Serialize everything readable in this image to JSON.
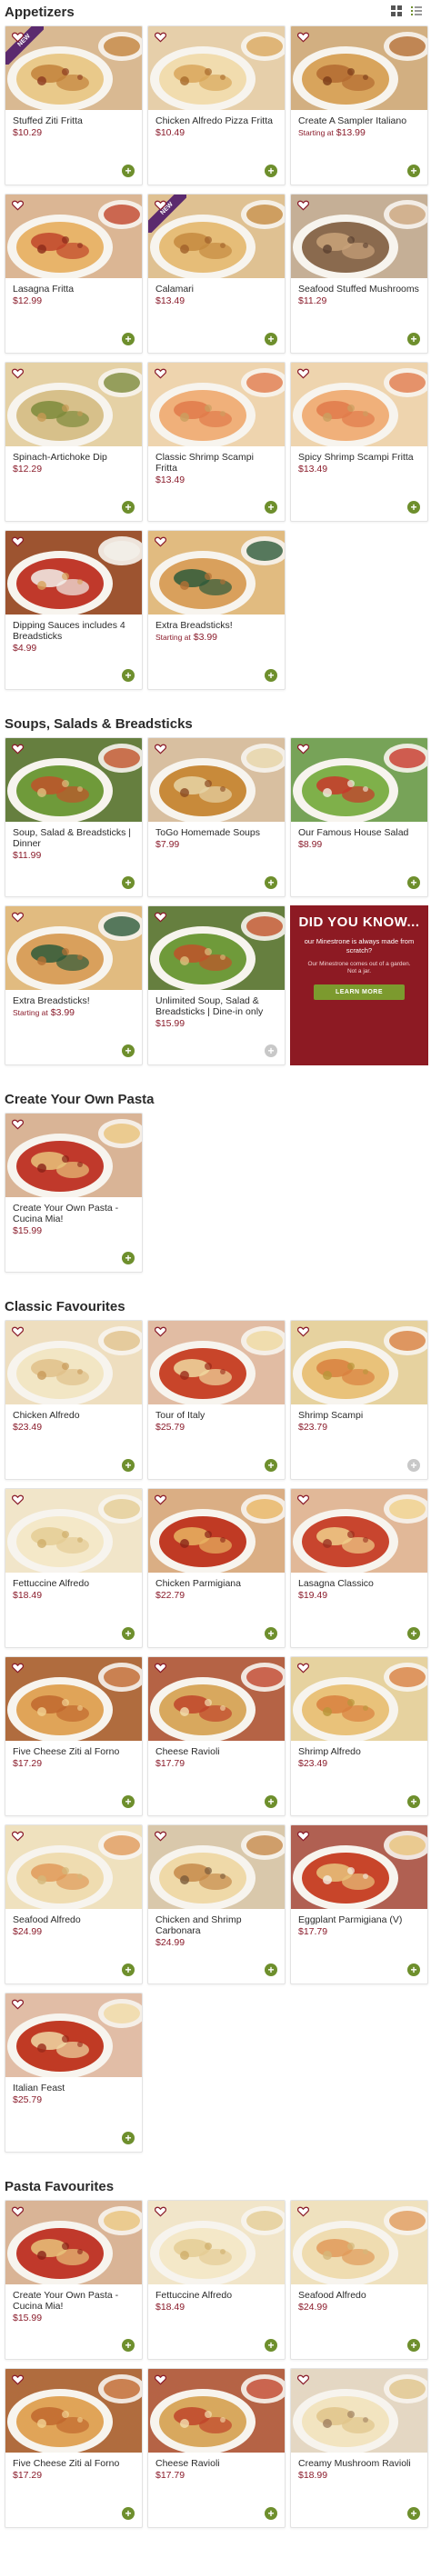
{
  "colors": {
    "accent_red": "#8a1c2b",
    "add_green": "#6e8f2d",
    "promo_bg": "#8d1a23",
    "new_badge": "#5b2a6e"
  },
  "view_toggle": {
    "grid_icon": "grid-view-icon",
    "list_icon": "list-view-icon"
  },
  "sections": [
    {
      "title": "Appetizers",
      "items": [
        {
          "name": "Stuffed Ziti Fritta",
          "price": "$10.29",
          "starting": "",
          "new": true,
          "img": "fritta"
        },
        {
          "name": "Chicken Alfredo Pizza Fritta",
          "price": "$10.49",
          "starting": "",
          "new": false,
          "img": "pizza-fritta"
        },
        {
          "name": "Create A Sampler Italiano",
          "price": "$13.99",
          "starting": "Starting at",
          "new": false,
          "img": "sampler"
        },
        {
          "name": "Lasagna Fritta",
          "price": "$12.99",
          "starting": "",
          "new": false,
          "img": "lasagna-fritta"
        },
        {
          "name": "Calamari",
          "price": "$13.49",
          "starting": "",
          "new": true,
          "img": "calamari"
        },
        {
          "name": "Seafood Stuffed Mushrooms",
          "price": "$11.29",
          "starting": "",
          "new": false,
          "img": "mushrooms"
        },
        {
          "name": "Spinach-Artichoke Dip",
          "price": "$12.29",
          "starting": "",
          "new": false,
          "img": "dip"
        },
        {
          "name": "Classic Shrimp Scampi Fritta",
          "price": "$13.49",
          "starting": "",
          "new": false,
          "img": "shrimp"
        },
        {
          "name": "Spicy Shrimp Scampi Fritta",
          "price": "$13.49",
          "starting": "",
          "new": false,
          "img": "shrimp"
        },
        {
          "name": "Dipping Sauces includes 4 Breadsticks",
          "price": "$4.99",
          "starting": "",
          "new": false,
          "img": "sauces"
        },
        {
          "name": "Extra Breadsticks!",
          "price": "$3.99",
          "starting": "Starting at",
          "new": false,
          "img": "breadsticks"
        }
      ]
    },
    {
      "title": "Soups, Salads & Breadsticks",
      "items": [
        {
          "name": "Soup, Salad & Breadsticks | Dinner",
          "price": "$11.99",
          "starting": "",
          "new": false,
          "img": "soup-salad"
        },
        {
          "name": "ToGo Homemade Soups",
          "price": "$7.99",
          "starting": "",
          "new": false,
          "img": "soups"
        },
        {
          "name": "Our Famous House Salad",
          "price": "$8.99",
          "starting": "",
          "new": false,
          "img": "salad"
        },
        {
          "name": "Extra Breadsticks!",
          "price": "$3.99",
          "starting": "Starting at",
          "new": false,
          "img": "breadsticks"
        },
        {
          "name": "Unlimited Soup, Salad & Breadsticks | Dine-in only",
          "price": "$15.99",
          "starting": "",
          "new": false,
          "img": "soup-salad",
          "disabled": true
        }
      ],
      "promo": {
        "title": "DID YOU KNOW...",
        "body": "our Minestrone is always made from scratch?",
        "sub": "Our Minestrone comes out of a garden. Not a jar.",
        "button": "LEARN MORE"
      }
    },
    {
      "title": "Create Your Own Pasta",
      "items": [
        {
          "name": "Create Your Own Pasta - Cucina Mia!",
          "price": "$15.99",
          "starting": "",
          "new": false,
          "img": "cyo"
        }
      ]
    },
    {
      "title": "Classic Favourites",
      "items": [
        {
          "name": "Chicken Alfredo",
          "price": "$23.49",
          "starting": "",
          "new": false,
          "img": "alfredo"
        },
        {
          "name": "Tour of Italy",
          "price": "$25.79",
          "starting": "",
          "new": false,
          "img": "tour"
        },
        {
          "name": "Shrimp Scampi",
          "price": "$23.79",
          "starting": "",
          "new": false,
          "img": "shrimp-pasta",
          "disabled": true
        },
        {
          "name": "Fettuccine Alfredo",
          "price": "$18.49",
          "starting": "",
          "new": false,
          "img": "fettuccine"
        },
        {
          "name": "Chicken Parmigiana",
          "price": "$22.79",
          "starting": "",
          "new": false,
          "img": "parm"
        },
        {
          "name": "Lasagna Classico",
          "price": "$19.49",
          "starting": "",
          "new": false,
          "img": "lasagna"
        },
        {
          "name": "Five Cheese Ziti al Forno",
          "price": "$17.29",
          "starting": "",
          "new": false,
          "img": "ziti"
        },
        {
          "name": "Cheese Ravioli",
          "price": "$17.79",
          "starting": "",
          "new": false,
          "img": "ravioli"
        },
        {
          "name": "Shrimp Alfredo",
          "price": "$23.49",
          "starting": "",
          "new": false,
          "img": "shrimp-pasta"
        },
        {
          "name": "Seafood Alfredo",
          "price": "$24.99",
          "starting": "",
          "new": false,
          "img": "seafood-alfredo"
        },
        {
          "name": "Chicken and Shrimp Carbonara",
          "price": "$24.99",
          "starting": "",
          "new": false,
          "img": "carbonara"
        },
        {
          "name": "Eggplant Parmigiana (V)",
          "price": "$17.79",
          "starting": "",
          "new": false,
          "img": "eggplant"
        },
        {
          "name": "Italian Feast",
          "price": "$25.79",
          "starting": "",
          "new": false,
          "img": "feast"
        }
      ]
    },
    {
      "title": "Pasta Favourites",
      "items": [
        {
          "name": "Create Your Own Pasta - Cucina Mia!",
          "price": "$15.99",
          "starting": "",
          "new": false,
          "img": "cyo"
        },
        {
          "name": "Fettuccine Alfredo",
          "price": "$18.49",
          "starting": "",
          "new": false,
          "img": "fettuccine"
        },
        {
          "name": "Seafood Alfredo",
          "price": "$24.99",
          "starting": "",
          "new": false,
          "img": "seafood-alfredo"
        },
        {
          "name": "Five Cheese Ziti al Forno",
          "price": "$17.29",
          "starting": "",
          "new": false,
          "img": "ziti"
        },
        {
          "name": "Cheese Ravioli",
          "price": "$17.79",
          "starting": "",
          "new": false,
          "img": "ravioli"
        },
        {
          "name": "Creamy Mushroom Ravioli",
          "price": "$18.99",
          "starting": "",
          "new": false,
          "img": "mushroom-ravioli"
        }
      ]
    }
  ],
  "badge_text": "NEW",
  "add_symbol": "+"
}
